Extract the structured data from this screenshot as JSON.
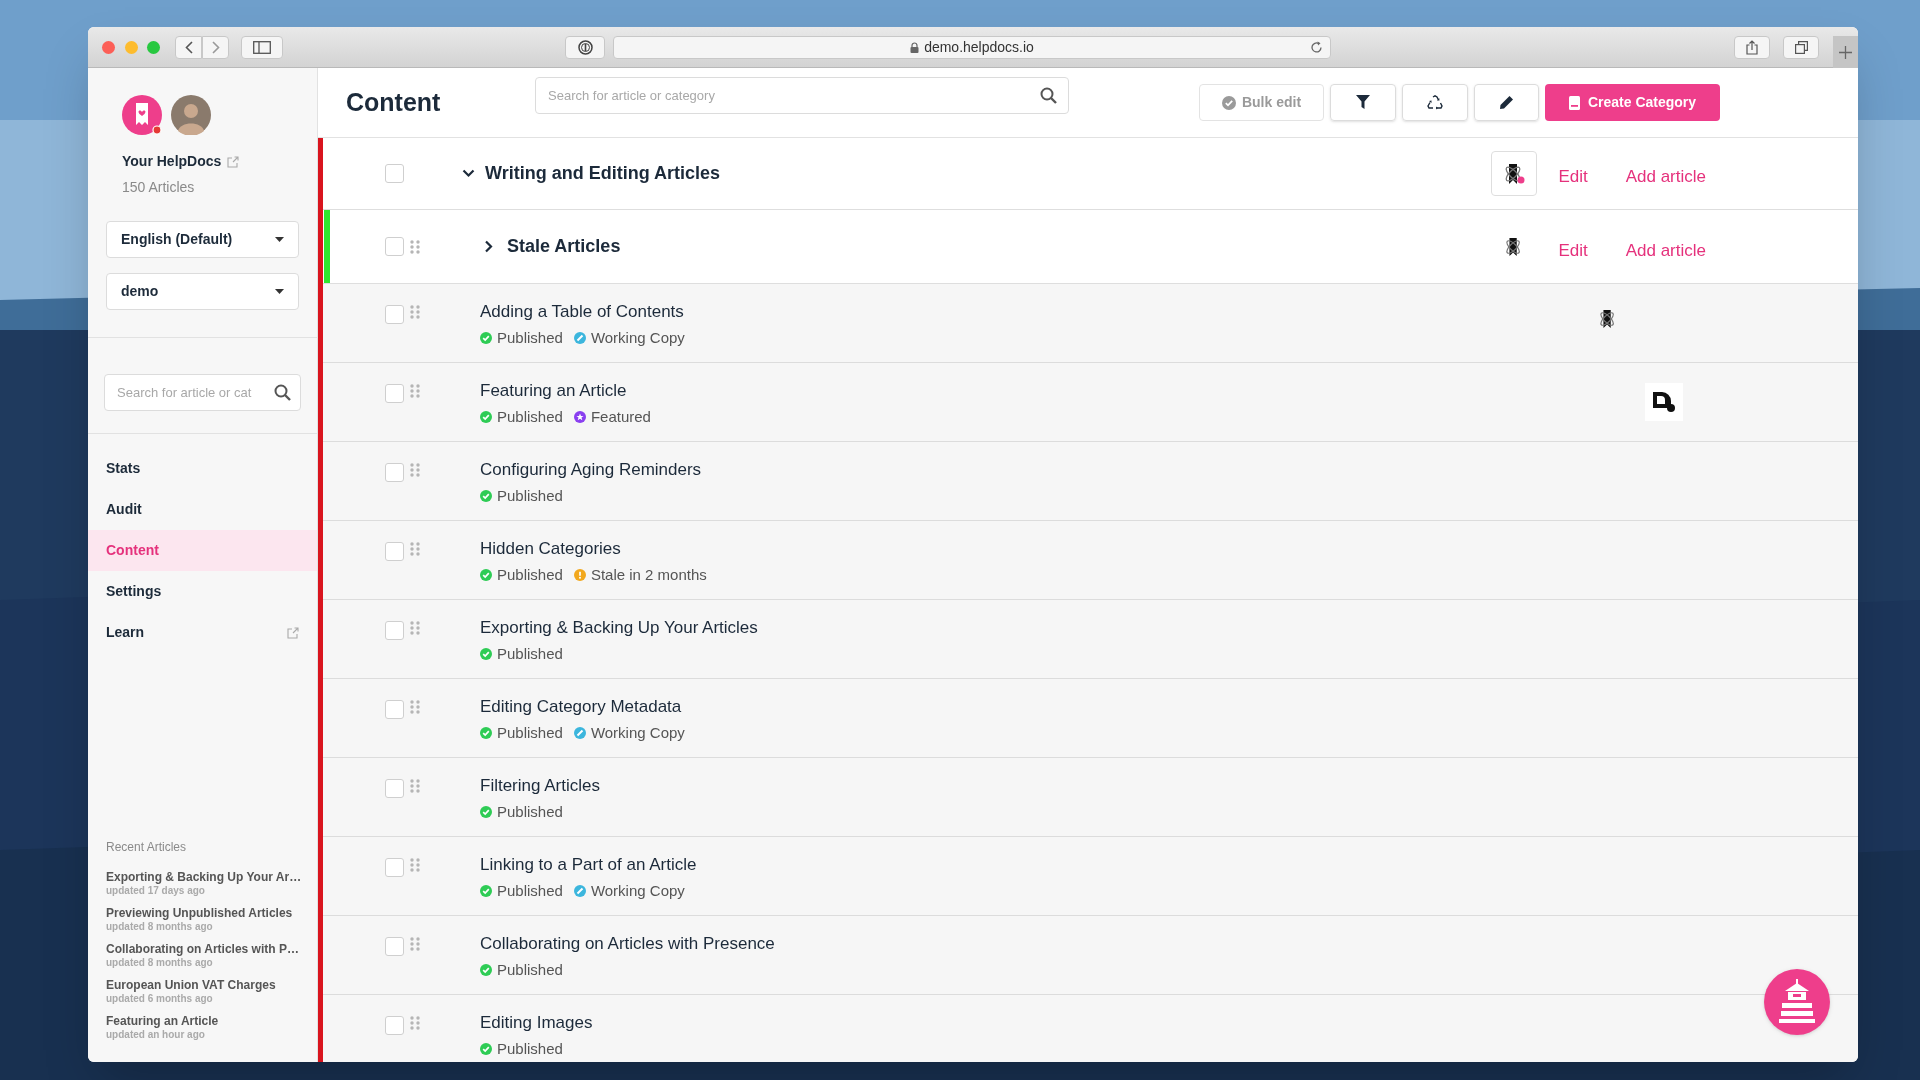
{
  "browser": {
    "url": "demo.helpdocs.io"
  },
  "sidebar": {
    "site_name": "Your HelpDocs",
    "article_count": "150 Articles",
    "language": "English (Default)",
    "workspace": "demo",
    "search": {
      "placeholder": "Search for article or cat"
    },
    "nav": [
      {
        "label": "Stats",
        "selected": false,
        "external": false
      },
      {
        "label": "Audit",
        "selected": false,
        "external": false
      },
      {
        "label": "Content",
        "selected": true,
        "external": false
      },
      {
        "label": "Settings",
        "selected": false,
        "external": false
      },
      {
        "label": "Learn",
        "selected": false,
        "external": true
      }
    ],
    "recent_heading": "Recent Articles",
    "recent": [
      {
        "title": "Exporting & Backing Up Your Ar…",
        "updated": "updated 17 days ago"
      },
      {
        "title": "Previewing Unpublished Articles",
        "updated": "updated 8 months ago"
      },
      {
        "title": "Collaborating on Articles with P…",
        "updated": "updated 8 months ago"
      },
      {
        "title": "European Union VAT Charges",
        "updated": "updated 6 months ago"
      },
      {
        "title": "Featuring an Article",
        "updated": "updated an hour ago"
      }
    ]
  },
  "header": {
    "title": "Content",
    "search": {
      "placeholder": "Search for article or category"
    },
    "bulk_edit": "Bulk edit",
    "create_category": "Create Category"
  },
  "categories": [
    {
      "kind": "category",
      "title": "Writing and Editing Articles",
      "expanded": true,
      "checked": false,
      "edit": "Edit",
      "add_article": "Add article"
    },
    {
      "kind": "subcategory",
      "title": "Stale Articles",
      "expanded": false,
      "checked": false,
      "edit": "Edit",
      "add_article": "Add article"
    }
  ],
  "articles": [
    {
      "title": "Adding a Table of Contents",
      "checked": false,
      "kind": "bookmark",
      "statuses": [
        {
          "kind": "published",
          "label": "Published"
        },
        {
          "kind": "working",
          "label": "Working Copy"
        }
      ]
    },
    {
      "title": "Featuring an Article",
      "checked": false,
      "kind": "page",
      "statuses": [
        {
          "kind": "published",
          "label": "Published"
        },
        {
          "kind": "featured",
          "label": "Featured"
        }
      ]
    },
    {
      "title": "Configuring Aging Reminders",
      "checked": false,
      "statuses": [
        {
          "kind": "published",
          "label": "Published"
        }
      ]
    },
    {
      "title": "Hidden Categories",
      "checked": false,
      "statuses": [
        {
          "kind": "published",
          "label": "Published"
        },
        {
          "kind": "stale",
          "label": "Stale in 2 months"
        }
      ]
    },
    {
      "title": "Exporting & Backing Up Your Articles",
      "checked": false,
      "statuses": [
        {
          "kind": "published",
          "label": "Published"
        }
      ]
    },
    {
      "title": "Editing Category Metadata",
      "checked": false,
      "statuses": [
        {
          "kind": "published",
          "label": "Published"
        },
        {
          "kind": "working",
          "label": "Working Copy"
        }
      ]
    },
    {
      "title": "Filtering Articles",
      "checked": false,
      "statuses": [
        {
          "kind": "published",
          "label": "Published"
        }
      ]
    },
    {
      "title": "Linking to a Part of an Article",
      "checked": false,
      "statuses": [
        {
          "kind": "published",
          "label": "Published"
        },
        {
          "kind": "working",
          "label": "Working Copy"
        }
      ]
    },
    {
      "title": "Collaborating on Articles with Presence",
      "checked": false,
      "statuses": [
        {
          "kind": "published",
          "label": "Published"
        }
      ]
    },
    {
      "title": "Editing Images",
      "checked": false,
      "statuses": [
        {
          "kind": "published",
          "label": "Published"
        }
      ]
    }
  ]
}
